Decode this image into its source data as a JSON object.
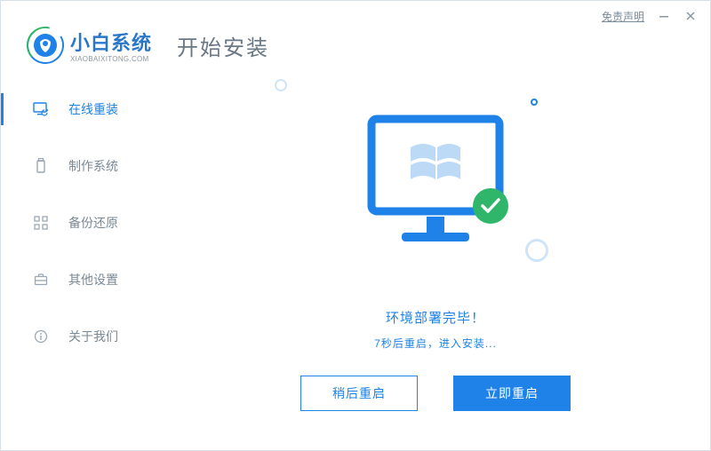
{
  "window": {
    "disclaimer_label": "免责声明"
  },
  "brand": {
    "name": "小白系统",
    "sub": "XIAOBAIXITONG.COM"
  },
  "page": {
    "title": "开始安装"
  },
  "sidebar": {
    "items": [
      {
        "label": "在线重装"
      },
      {
        "label": "制作系统"
      },
      {
        "label": "备份还原"
      },
      {
        "label": "其他设置"
      },
      {
        "label": "关于我们"
      }
    ]
  },
  "status": {
    "headline": "环境部署完毕！",
    "countdown": "7秒后重启，进入安装..."
  },
  "actions": {
    "later": "稍后重启",
    "now": "立即重启"
  }
}
